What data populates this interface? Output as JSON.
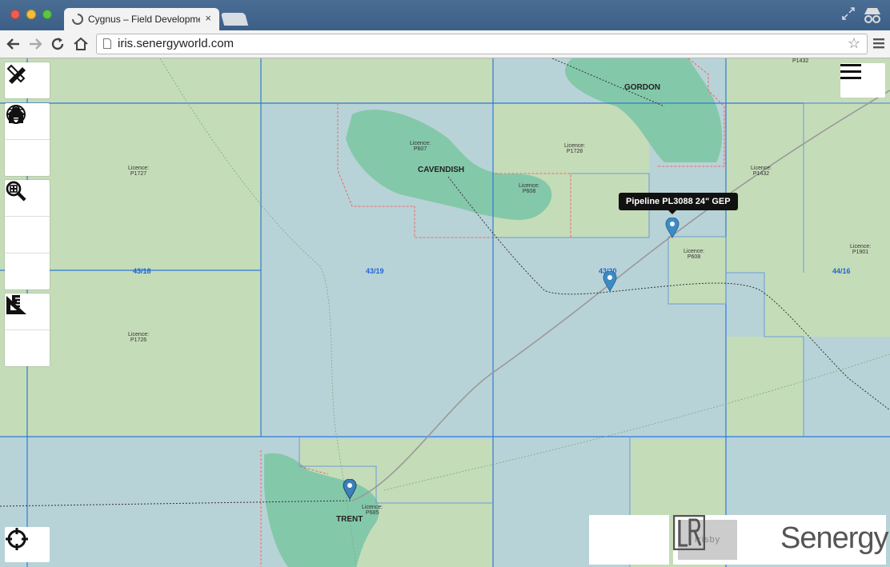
{
  "browser": {
    "tab_title": "Cygnus – Field Developme",
    "tab_close": "×",
    "url": "iris.senergyworld.com",
    "star": "☆"
  },
  "map": {
    "blocks": [
      "43/18",
      "43/19",
      "43/20",
      "44/16"
    ],
    "licences": [
      {
        "label": "Licence:",
        "code": "P1727"
      },
      {
        "label": "Licence:",
        "code": "P1726"
      },
      {
        "label": "Licence:",
        "code": "P607"
      },
      {
        "label": "Licence:",
        "code": "P608"
      },
      {
        "label": "Licence:",
        "code": "P1728"
      },
      {
        "label": "Licence:",
        "code": "P1432"
      },
      {
        "label": "Licence:",
        "code": "P608"
      },
      {
        "label": "Licence:",
        "code": "P1901"
      },
      {
        "label": "Licence:",
        "code": "P685"
      },
      {
        "label": "",
        "code": "P1432"
      }
    ],
    "fields": [
      "GORDON",
      "CAVENDISH",
      "TRENT"
    ],
    "tooltip": "Pipeline PL3088 24\" GEP"
  },
  "controls": {
    "tools": [
      "edit-tools",
      "globe",
      "home",
      "zoom-in",
      "zoom-out",
      "zoom-extent",
      "ruler",
      "set-square",
      "locate",
      "menu"
    ]
  },
  "branding": {
    "irisby": "Irisby",
    "company": "Senergy"
  }
}
